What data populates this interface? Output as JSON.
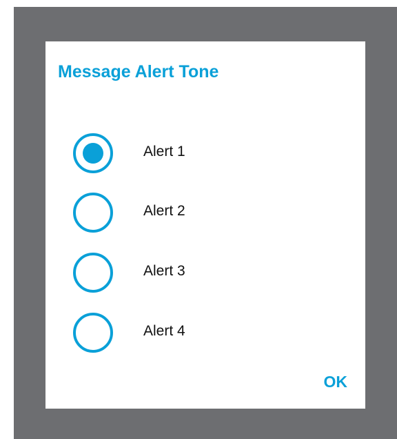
{
  "dialog": {
    "title": "Message Alert Tone",
    "options": [
      {
        "label": "Alert 1",
        "selected": true
      },
      {
        "label": "Alert 2",
        "selected": false
      },
      {
        "label": "Alert 3",
        "selected": false
      },
      {
        "label": "Alert 4",
        "selected": false
      }
    ],
    "ok_label": "OK"
  },
  "colors": {
    "accent": "#0aa0d8",
    "backdrop": "#6d6e71",
    "dialog_bg": "#ffffff",
    "text": "#111111"
  }
}
